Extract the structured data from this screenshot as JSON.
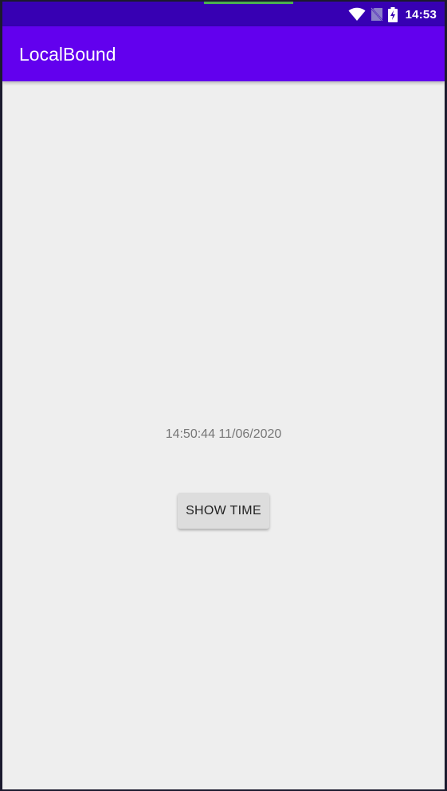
{
  "status_bar": {
    "time": "14:53",
    "icons": [
      "wifi-icon",
      "no-sim-icon",
      "battery-charging-icon"
    ],
    "background": "#3700b3"
  },
  "app_bar": {
    "title": "LocalBound",
    "background": "#6200ee"
  },
  "main": {
    "time_display": "14:50:44 11/06/2020",
    "show_time_button": "SHOW TIME",
    "background": "#eeeeee"
  }
}
